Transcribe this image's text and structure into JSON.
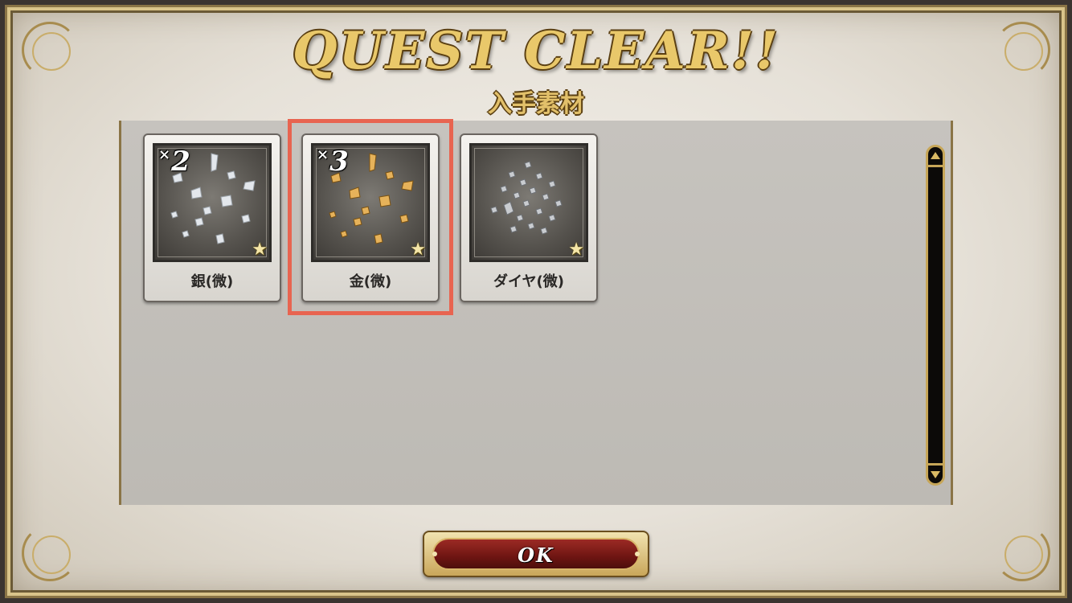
{
  "header": {
    "title": "QUEST CLEAR!!",
    "subtitle": "入手素材"
  },
  "materials": [
    {
      "name": "銀(微)",
      "quantity": "2",
      "quantity_prefix": "×",
      "rarity_icon": "star-icon",
      "color": "#d8dde3"
    },
    {
      "name": "金(微)",
      "quantity": "3",
      "quantity_prefix": "×",
      "rarity_icon": "star-icon",
      "color": "#e0a84a",
      "selected": true
    },
    {
      "name": "ダイヤ(微)",
      "quantity": "",
      "quantity_prefix": "",
      "rarity_icon": "star-icon",
      "color": "#c9ccd0"
    }
  ],
  "ok_button": {
    "label": "OK"
  },
  "colors": {
    "highlight": "#e86450",
    "gold": "#e9c86a"
  }
}
